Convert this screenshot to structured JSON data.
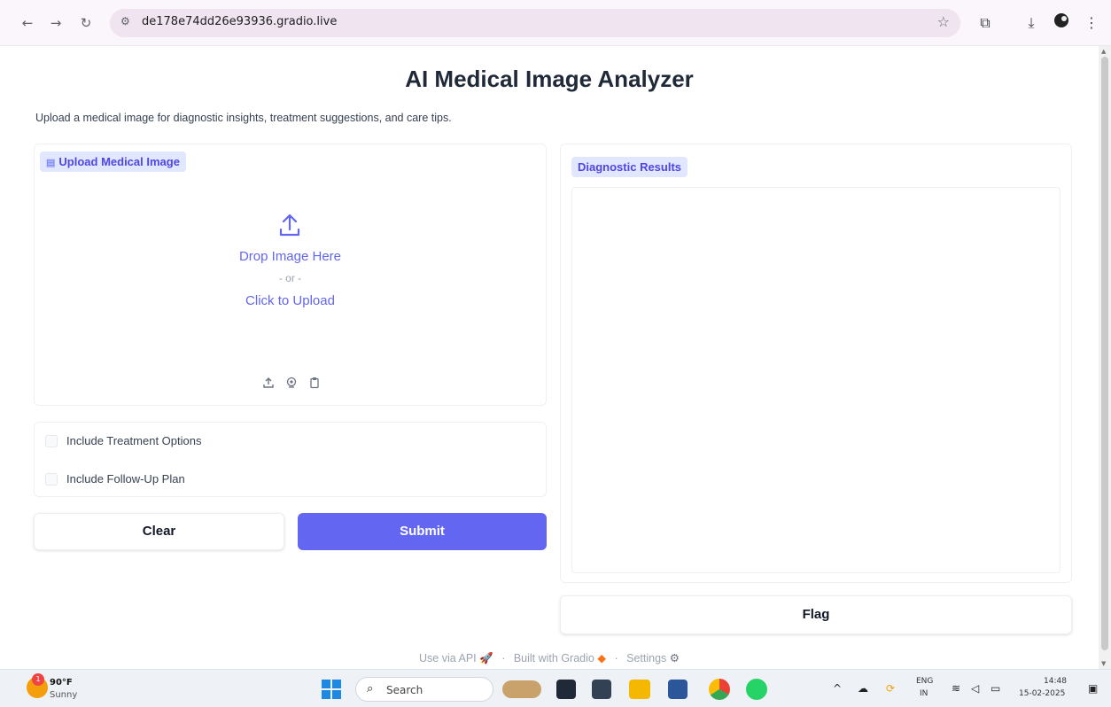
{
  "browser": {
    "url": "de178e74dd26e93936.gradio.live"
  },
  "page": {
    "title": "AI Medical Image Analyzer",
    "description": "Upload a medical image for diagnostic insights, treatment suggestions, and care tips."
  },
  "upload": {
    "label": "Upload Medical Image",
    "drop_text": "Drop Image Here",
    "or_text": "- or -",
    "click_text": "Click to Upload",
    "source_icons": [
      "upload-icon",
      "webcam-icon",
      "clipboard-icon"
    ]
  },
  "options": {
    "treatment": "Include Treatment Options",
    "followup": "Include Follow-Up Plan"
  },
  "buttons": {
    "clear": "Clear",
    "submit": "Submit",
    "flag": "Flag"
  },
  "results": {
    "label": "Diagnostic Results"
  },
  "footer": {
    "api": "Use via API",
    "built": "Built with Gradio",
    "settings": "Settings"
  },
  "taskbar": {
    "temp": "90°F",
    "condition": "Sunny",
    "badge": "1",
    "search": "Search",
    "lang_top": "ENG",
    "lang_bottom": "IN",
    "time": "14:48",
    "date": "15-02-2025"
  },
  "colors": {
    "accent": "#6366f1",
    "chip_bg": "#e0e7ff"
  }
}
